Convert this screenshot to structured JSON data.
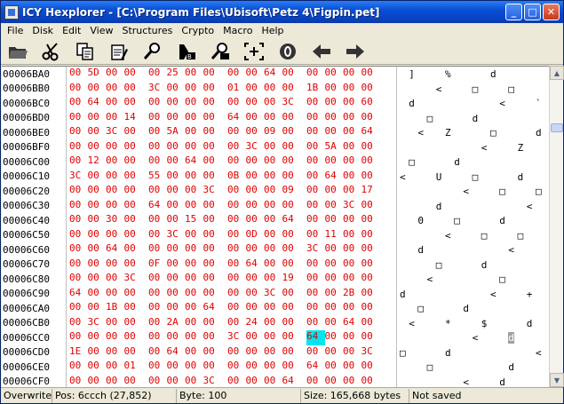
{
  "window": {
    "title": "ICY Hexplorer - [C:\\Program Files\\Ubisoft\\Petz 4\\Figpin.pet]",
    "min_label": "_",
    "max_label": "□",
    "close_label": "✕"
  },
  "menu": [
    {
      "label": "File"
    },
    {
      "label": "Disk"
    },
    {
      "label": "Edit"
    },
    {
      "label": "View"
    },
    {
      "label": "Structures"
    },
    {
      "label": "Crypto"
    },
    {
      "label": "Macro"
    },
    {
      "label": "Help"
    }
  ],
  "toolbar": {
    "buttons": [
      {
        "name": "open-file-icon"
      },
      {
        "name": "cut-icon"
      },
      {
        "name": "copy-icon"
      },
      {
        "name": "paste-icon"
      },
      {
        "name": "find-icon"
      },
      {
        "name": "find-binary-icon"
      },
      {
        "name": "replace-icon"
      },
      {
        "name": "goto-offset-icon"
      },
      {
        "name": "zero-icon"
      },
      {
        "name": "back-arrow-icon"
      },
      {
        "name": "forward-arrow-icon"
      }
    ]
  },
  "hex_rows": [
    {
      "addr": "00006BA0",
      "bytes": [
        "00",
        "5D",
        "00",
        "00",
        "00",
        "25",
        "00",
        "00",
        "00",
        "00",
        "64",
        "00",
        "00",
        "00",
        "00",
        "00"
      ]
    },
    {
      "addr": "00006BB0",
      "bytes": [
        "00",
        "00",
        "00",
        "00",
        "3C",
        "00",
        "00",
        "00",
        "01",
        "00",
        "00",
        "00",
        "1B",
        "00",
        "00",
        "00"
      ]
    },
    {
      "addr": "00006BC0",
      "bytes": [
        "00",
        "64",
        "00",
        "00",
        "00",
        "00",
        "00",
        "00",
        "00",
        "00",
        "00",
        "3C",
        "00",
        "00",
        "00",
        "60"
      ]
    },
    {
      "addr": "00006BD0",
      "bytes": [
        "00",
        "00",
        "00",
        "14",
        "00",
        "00",
        "00",
        "00",
        "64",
        "00",
        "00",
        "00",
        "00",
        "00",
        "00",
        "00"
      ]
    },
    {
      "addr": "00006BE0",
      "bytes": [
        "00",
        "00",
        "3C",
        "00",
        "00",
        "5A",
        "00",
        "00",
        "00",
        "00",
        "09",
        "00",
        "00",
        "00",
        "00",
        "64"
      ]
    },
    {
      "addr": "00006BF0",
      "bytes": [
        "00",
        "00",
        "00",
        "00",
        "00",
        "00",
        "00",
        "00",
        "00",
        "3C",
        "00",
        "00",
        "00",
        "5A",
        "00",
        "00"
      ]
    },
    {
      "addr": "00006C00",
      "bytes": [
        "00",
        "12",
        "00",
        "00",
        "00",
        "00",
        "64",
        "00",
        "00",
        "00",
        "00",
        "00",
        "00",
        "00",
        "00",
        "00"
      ]
    },
    {
      "addr": "00006C10",
      "bytes": [
        "3C",
        "00",
        "00",
        "00",
        "55",
        "00",
        "00",
        "00",
        "0B",
        "00",
        "00",
        "00",
        "00",
        "64",
        "00",
        "00"
      ]
    },
    {
      "addr": "00006C20",
      "bytes": [
        "00",
        "00",
        "00",
        "00",
        "00",
        "00",
        "00",
        "3C",
        "00",
        "00",
        "00",
        "09",
        "00",
        "00",
        "00",
        "17"
      ]
    },
    {
      "addr": "00006C30",
      "bytes": [
        "00",
        "00",
        "00",
        "00",
        "64",
        "00",
        "00",
        "00",
        "00",
        "00",
        "00",
        "00",
        "00",
        "00",
        "3C",
        "00"
      ]
    },
    {
      "addr": "00006C40",
      "bytes": [
        "00",
        "00",
        "30",
        "00",
        "00",
        "00",
        "15",
        "00",
        "00",
        "00",
        "00",
        "64",
        "00",
        "00",
        "00",
        "00"
      ]
    },
    {
      "addr": "00006C50",
      "bytes": [
        "00",
        "00",
        "00",
        "00",
        "00",
        "3C",
        "00",
        "00",
        "00",
        "0D",
        "00",
        "00",
        "00",
        "11",
        "00",
        "00"
      ]
    },
    {
      "addr": "00006C60",
      "bytes": [
        "00",
        "00",
        "64",
        "00",
        "00",
        "00",
        "00",
        "00",
        "00",
        "00",
        "00",
        "00",
        "3C",
        "00",
        "00",
        "00"
      ]
    },
    {
      "addr": "00006C70",
      "bytes": [
        "00",
        "00",
        "00",
        "00",
        "0F",
        "00",
        "00",
        "00",
        "00",
        "64",
        "00",
        "00",
        "00",
        "00",
        "00",
        "00"
      ]
    },
    {
      "addr": "00006C80",
      "bytes": [
        "00",
        "00",
        "00",
        "3C",
        "00",
        "00",
        "00",
        "00",
        "00",
        "00",
        "00",
        "19",
        "00",
        "00",
        "00",
        "00"
      ]
    },
    {
      "addr": "00006C90",
      "bytes": [
        "64",
        "00",
        "00",
        "00",
        "00",
        "00",
        "00",
        "00",
        "00",
        "00",
        "3C",
        "00",
        "00",
        "00",
        "2B",
        "00"
      ]
    },
    {
      "addr": "00006CA0",
      "bytes": [
        "00",
        "00",
        "1B",
        "00",
        "00",
        "00",
        "00",
        "64",
        "00",
        "00",
        "00",
        "00",
        "00",
        "00",
        "00",
        "00"
      ]
    },
    {
      "addr": "00006CB0",
      "bytes": [
        "00",
        "3C",
        "00",
        "00",
        "00",
        "2A",
        "00",
        "00",
        "00",
        "24",
        "00",
        "00",
        "00",
        "00",
        "64",
        "00"
      ]
    },
    {
      "addr": "00006CC0",
      "bytes": [
        "00",
        "00",
        "00",
        "00",
        "00",
        "00",
        "00",
        "00",
        "3C",
        "00",
        "00",
        "00",
        "64",
        "00",
        "00",
        "00"
      ]
    },
    {
      "addr": "00006CD0",
      "bytes": [
        "1E",
        "00",
        "00",
        "00",
        "00",
        "64",
        "00",
        "00",
        "00",
        "00",
        "00",
        "00",
        "00",
        "00",
        "00",
        "3C"
      ]
    },
    {
      "addr": "00006CE0",
      "bytes": [
        "00",
        "00",
        "00",
        "01",
        "00",
        "00",
        "00",
        "00",
        "00",
        "00",
        "00",
        "00",
        "64",
        "00",
        "00",
        "00"
      ]
    },
    {
      "addr": "00006CF0",
      "bytes": [
        "00",
        "00",
        "00",
        "00",
        "00",
        "00",
        "00",
        "3C",
        "00",
        "00",
        "00",
        "64",
        "00",
        "00",
        "00",
        "00"
      ]
    }
  ],
  "ascii_rows": [
    [
      {
        "c": "]",
        "col": 1
      },
      {
        "c": "%",
        "col": 5
      },
      {
        "c": "d",
        "col": 10
      }
    ],
    [
      {
        "c": "<",
        "col": 4
      },
      {
        "c": "□",
        "col": 8
      },
      {
        "c": "□",
        "col": 12
      }
    ],
    [
      {
        "c": "d",
        "col": 1
      },
      {
        "c": "<",
        "col": 11
      },
      {
        "c": "`",
        "col": 15
      }
    ],
    [
      {
        "c": "□",
        "col": 3
      },
      {
        "c": "d",
        "col": 8
      }
    ],
    [
      {
        "c": "<",
        "col": 2
      },
      {
        "c": "Z",
        "col": 5
      },
      {
        "c": "□",
        "col": 10
      },
      {
        "c": "d",
        "col": 15
      }
    ],
    [
      {
        "c": "<",
        "col": 9
      },
      {
        "c": "Z",
        "col": 13
      }
    ],
    [
      {
        "c": "□",
        "col": 1
      },
      {
        "c": "d",
        "col": 6
      }
    ],
    [
      {
        "c": "<",
        "col": 0
      },
      {
        "c": "U",
        "col": 4
      },
      {
        "c": "□",
        "col": 8
      },
      {
        "c": "d",
        "col": 13
      }
    ],
    [
      {
        "c": "<",
        "col": 7
      },
      {
        "c": "□",
        "col": 11
      },
      {
        "c": "□",
        "col": 15
      }
    ],
    [
      {
        "c": "d",
        "col": 4
      },
      {
        "c": "<",
        "col": 14
      }
    ],
    [
      {
        "c": "0",
        "col": 2
      },
      {
        "c": "□",
        "col": 6
      },
      {
        "c": "d",
        "col": 11
      }
    ],
    [
      {
        "c": "<",
        "col": 5
      },
      {
        "c": "□",
        "col": 9
      },
      {
        "c": "□",
        "col": 13
      }
    ],
    [
      {
        "c": "d",
        "col": 2
      },
      {
        "c": "<",
        "col": 12
      }
    ],
    [
      {
        "c": "□",
        "col": 4
      },
      {
        "c": "d",
        "col": 9
      }
    ],
    [
      {
        "c": "<",
        "col": 3
      },
      {
        "c": "□",
        "col": 11
      }
    ],
    [
      {
        "c": "d",
        "col": 0
      },
      {
        "c": "<",
        "col": 10
      },
      {
        "c": "+",
        "col": 14
      }
    ],
    [
      {
        "c": "□",
        "col": 2
      },
      {
        "c": "d",
        "col": 7
      }
    ],
    [
      {
        "c": "<",
        "col": 1
      },
      {
        "c": "*",
        "col": 5
      },
      {
        "c": "$",
        "col": 9
      },
      {
        "c": "d",
        "col": 14
      }
    ],
    [
      {
        "c": "<",
        "col": 8
      },
      {
        "c": "d",
        "col": 12,
        "hl": true
      }
    ],
    [
      {
        "c": "□",
        "col": 0
      },
      {
        "c": "d",
        "col": 5
      },
      {
        "c": "<",
        "col": 15
      }
    ],
    [
      {
        "c": "□",
        "col": 3
      },
      {
        "c": "d",
        "col": 12
      }
    ],
    [
      {
        "c": "<",
        "col": 7
      },
      {
        "c": "d",
        "col": 11
      }
    ]
  ],
  "highlight": {
    "row": 18,
    "byte": 12,
    "cursor_color": "#00e5ee"
  },
  "status": {
    "mode": "Overwrite",
    "pos": "Pos: 6ccch (27,852)",
    "byte": "Byte: 100",
    "size": "Size: 165,668 bytes",
    "saved": "Not saved"
  }
}
